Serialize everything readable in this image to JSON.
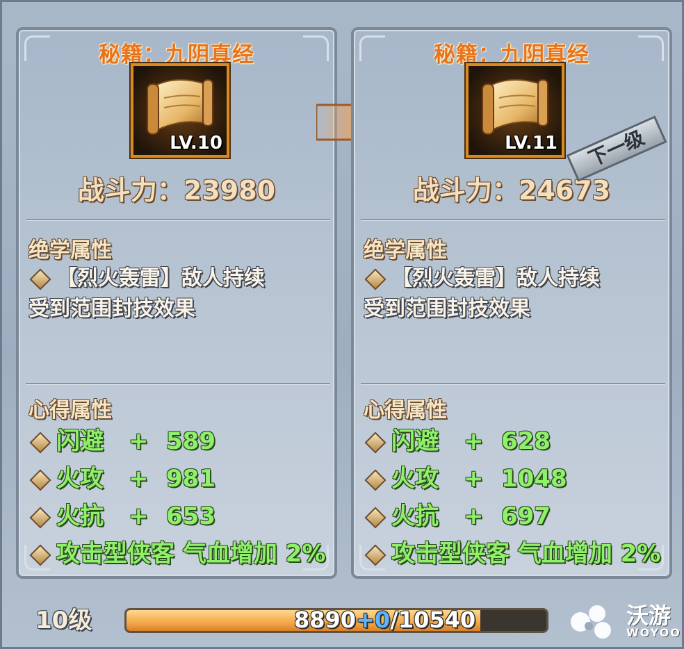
{
  "left": {
    "title": "秘籍：九阴真经",
    "level": "LV.10",
    "power": "战斗力：23980",
    "skill_header": "绝学属性",
    "skill_desc_line1": "【烈火轰雷】敌人持续",
    "skill_desc_line2": "受到范围封技效果",
    "insight_header": "心得属性",
    "stats": [
      {
        "name": "闪避",
        "plus": "+",
        "value": "589"
      },
      {
        "name": "火攻",
        "plus": "+",
        "value": "981"
      },
      {
        "name": "火抗",
        "plus": "+",
        "value": "653"
      }
    ],
    "bonus": "攻击型侠客 气血增加 2%"
  },
  "right": {
    "title": "秘籍：九阴真经",
    "level": "LV.11",
    "power": "战斗力：24673",
    "next_tag": "下一级",
    "skill_header": "绝学属性",
    "skill_desc_line1": "【烈火轰雷】敌人持续",
    "skill_desc_line2": "受到范围封技效果",
    "insight_header": "心得属性",
    "stats": [
      {
        "name": "闪避",
        "plus": "+",
        "value": "628"
      },
      {
        "name": "火攻",
        "plus": "+",
        "value": "1048"
      },
      {
        "name": "火抗",
        "plus": "+",
        "value": "697"
      }
    ],
    "bonus": "攻击型侠客 气血增加 2%"
  },
  "footer": {
    "level_label": "10级",
    "exp_current": "8890",
    "exp_gain": "+0",
    "exp_max": "/10540",
    "exp_fraction": 0.843
  },
  "logo": {
    "name": "沃游",
    "sub": "WOYOO"
  },
  "icons": {
    "book": "scroll-icon",
    "upgrade_arrow": "arrow-right-icon",
    "bullet": "diamond-icon"
  }
}
